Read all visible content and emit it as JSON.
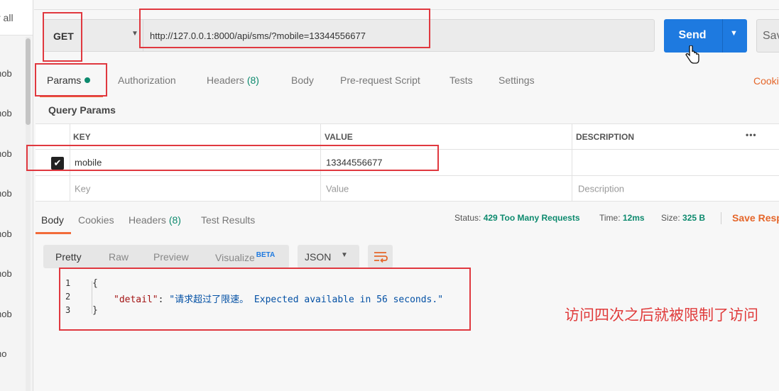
{
  "sidebar": {
    "view_all": "r all",
    "items": [
      "nob",
      "nob",
      "nob",
      "nob",
      "nob",
      "nob",
      "nob",
      "ho"
    ]
  },
  "request": {
    "method": "GET",
    "url": "http://127.0.0.1:8000/api/sms/?mobile=13344556677",
    "send_label": "Send",
    "save_label": "Sav"
  },
  "request_tabs": {
    "params": "Params",
    "authorization": "Authorization",
    "headers": "Headers",
    "headers_count": "(8)",
    "body": "Body",
    "prerequest": "Pre-request Script",
    "tests": "Tests",
    "settings": "Settings",
    "cookies": "Cooki"
  },
  "query_params": {
    "title": "Query Params",
    "columns": {
      "key": "KEY",
      "value": "VALUE",
      "description": "DESCRIPTION"
    },
    "rows": [
      {
        "key": "mobile",
        "value": "13344556677",
        "description": ""
      }
    ],
    "placeholder": {
      "key": "Key",
      "value": "Value",
      "description": "Description"
    }
  },
  "response": {
    "tabs": {
      "body": "Body",
      "cookies": "Cookies",
      "headers": "Headers",
      "headers_count": "(8)",
      "test_results": "Test Results"
    },
    "status_label": "Status:",
    "status_value": "429 Too Many Requests",
    "time_label": "Time:",
    "time_value": "12ms",
    "size_label": "Size:",
    "size_value": "325 B",
    "save_response": "Save Resp",
    "formats": {
      "pretty": "Pretty",
      "raw": "Raw",
      "preview": "Preview",
      "visualize": "Visualize",
      "beta": "BETA"
    },
    "language": "JSON",
    "code": {
      "line1_no": "1",
      "line2_no": "2",
      "line3_no": "3",
      "open_brace": "{",
      "key": "\"detail\"",
      "colon": ": ",
      "value": "\"请求超过了限速。 Expected available in 56 seconds.\"",
      "close_brace": "}"
    }
  },
  "annotation": "访问四次之后就被限制了访问",
  "colors": {
    "accent_orange": "#f26b3a",
    "send_blue": "#1e7ae0",
    "status_green": "#0d8a6e",
    "annotation_red": "#e0383f"
  }
}
